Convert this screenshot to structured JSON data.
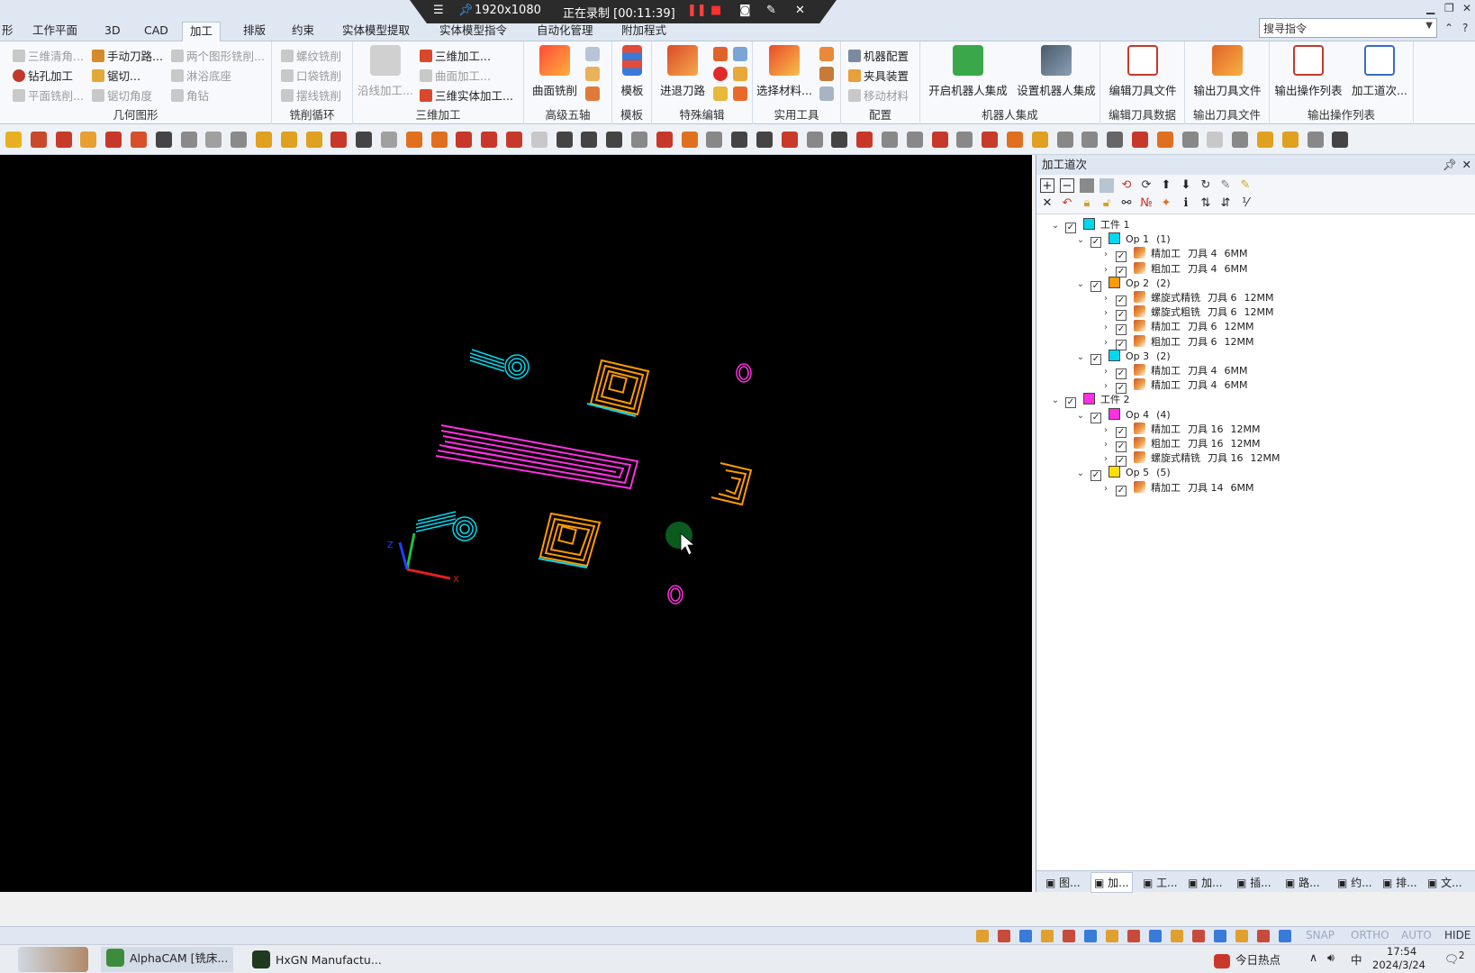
{
  "ribbon_tabs": [
    "形",
    "工作平面",
    "3D",
    "CAD",
    "加工",
    "排版",
    "约束",
    "实体模型提取",
    "实体模型指令",
    "自动化管理",
    "附加程式"
  ],
  "active_tab": "加工",
  "search": {
    "placeholder": "搜寻指令"
  },
  "recording": {
    "resolution": "1920x1080",
    "status": "正在录制 [00:11:39]"
  },
  "groups": {
    "geometry": {
      "label": "几何图形",
      "items": [
        "三维清角...",
        "手动刀路...",
        "两个图形铣削...",
        "钻孔加工",
        "锯切...",
        "淋浴底座",
        "平面铣削...",
        "锯切角度",
        "角钻"
      ]
    },
    "cycles": {
      "label": "铣削循环",
      "items": [
        "螺纹铣削",
        "口袋铣削",
        "摆线铣削"
      ]
    },
    "threed": {
      "label": "三维加工",
      "items": [
        "沿线加工...",
        "三维加工...",
        "曲面加工...",
        "三维实体加工..."
      ]
    },
    "five_axis": {
      "label": "高级五轴",
      "button": "曲面铣削"
    },
    "template": {
      "label": "模板",
      "button": "模板"
    },
    "special": {
      "label": "特殊编辑",
      "button": "进退刀路"
    },
    "utility": {
      "label": "实用工具",
      "button": "选择材料..."
    },
    "config": {
      "label": "配置",
      "items": [
        "机器配置",
        "夹具装置",
        "移动材料"
      ]
    },
    "robot": {
      "label": "机器人集成",
      "buttons": [
        "开启机器人集成",
        "设置机器人集成"
      ]
    },
    "tool_data": {
      "label": "编辑刀具数据",
      "button": "编辑刀具文件"
    },
    "tool_out": {
      "label": "输出刀具文件",
      "button": "输出刀具文件"
    },
    "op_list": {
      "label": "输出操作列表",
      "buttons": [
        "输出操作列表",
        "加工道次..."
      ]
    }
  },
  "panel": {
    "title": "加工道次",
    "tree": [
      {
        "level": 0,
        "kind": "part",
        "label": "工件 1",
        "color": "#00d8f0"
      },
      {
        "level": 1,
        "kind": "op",
        "label": "Op 1",
        "count": "(1)",
        "color": "#00d8f0"
      },
      {
        "level": 2,
        "kind": "pass",
        "label": "精加工",
        "tool": "刀具 4",
        "size": "6MM"
      },
      {
        "level": 2,
        "kind": "pass",
        "label": "粗加工",
        "tool": "刀具 4",
        "size": "6MM"
      },
      {
        "level": 1,
        "kind": "op",
        "label": "Op 2",
        "count": "(2)",
        "color": "#ff9a00"
      },
      {
        "level": 2,
        "kind": "pass",
        "label": "螺旋式精铣",
        "tool": "刀具 6",
        "size": "12MM"
      },
      {
        "level": 2,
        "kind": "pass",
        "label": "螺旋式粗铣",
        "tool": "刀具 6",
        "size": "12MM"
      },
      {
        "level": 2,
        "kind": "pass",
        "label": "精加工",
        "tool": "刀具 6",
        "size": "12MM"
      },
      {
        "level": 2,
        "kind": "pass",
        "label": "粗加工",
        "tool": "刀具 6",
        "size": "12MM"
      },
      {
        "level": 1,
        "kind": "op",
        "label": "Op 3",
        "count": "(2)",
        "color": "#00d8f0"
      },
      {
        "level": 2,
        "kind": "pass",
        "label": "精加工",
        "tool": "刀具 4",
        "size": "6MM"
      },
      {
        "level": 2,
        "kind": "pass",
        "label": "精加工",
        "tool": "刀具 4",
        "size": "6MM"
      },
      {
        "level": 0,
        "kind": "part",
        "label": "工件 2",
        "color": "#ff30e0"
      },
      {
        "level": 1,
        "kind": "op",
        "label": "Op 4",
        "count": "(4)",
        "color": "#ff30e0"
      },
      {
        "level": 2,
        "kind": "pass",
        "label": "精加工",
        "tool": "刀具 16",
        "size": "12MM"
      },
      {
        "level": 2,
        "kind": "pass",
        "label": "粗加工",
        "tool": "刀具 16",
        "size": "12MM"
      },
      {
        "level": 2,
        "kind": "pass",
        "label": "螺旋式精铣",
        "tool": "刀具 16",
        "size": "12MM"
      },
      {
        "level": 1,
        "kind": "op",
        "label": "Op 5",
        "count": "(5)",
        "color": "#ffe000"
      },
      {
        "level": 2,
        "kind": "pass",
        "label": "精加工",
        "tool": "刀具 14",
        "size": "6MM"
      }
    ],
    "bottom_tabs": [
      "图...",
      "加...",
      "工...",
      "加...",
      "插...",
      "路...",
      "约...",
      "排...",
      "文..."
    ]
  },
  "status_bar": {
    "snap": "SNAP",
    "ortho": "ORTHO",
    "auto": "AUTO",
    "hide": "HIDE"
  },
  "taskbar": {
    "apps": [
      "AlphaCAM [铣床...",
      "HxGN Manufactu..."
    ],
    "news": "今日热点",
    "ime": "中",
    "time": "17:54",
    "date": "2024/3/24",
    "notifications": "2"
  },
  "axes": {
    "x": "X",
    "z": "Z"
  }
}
